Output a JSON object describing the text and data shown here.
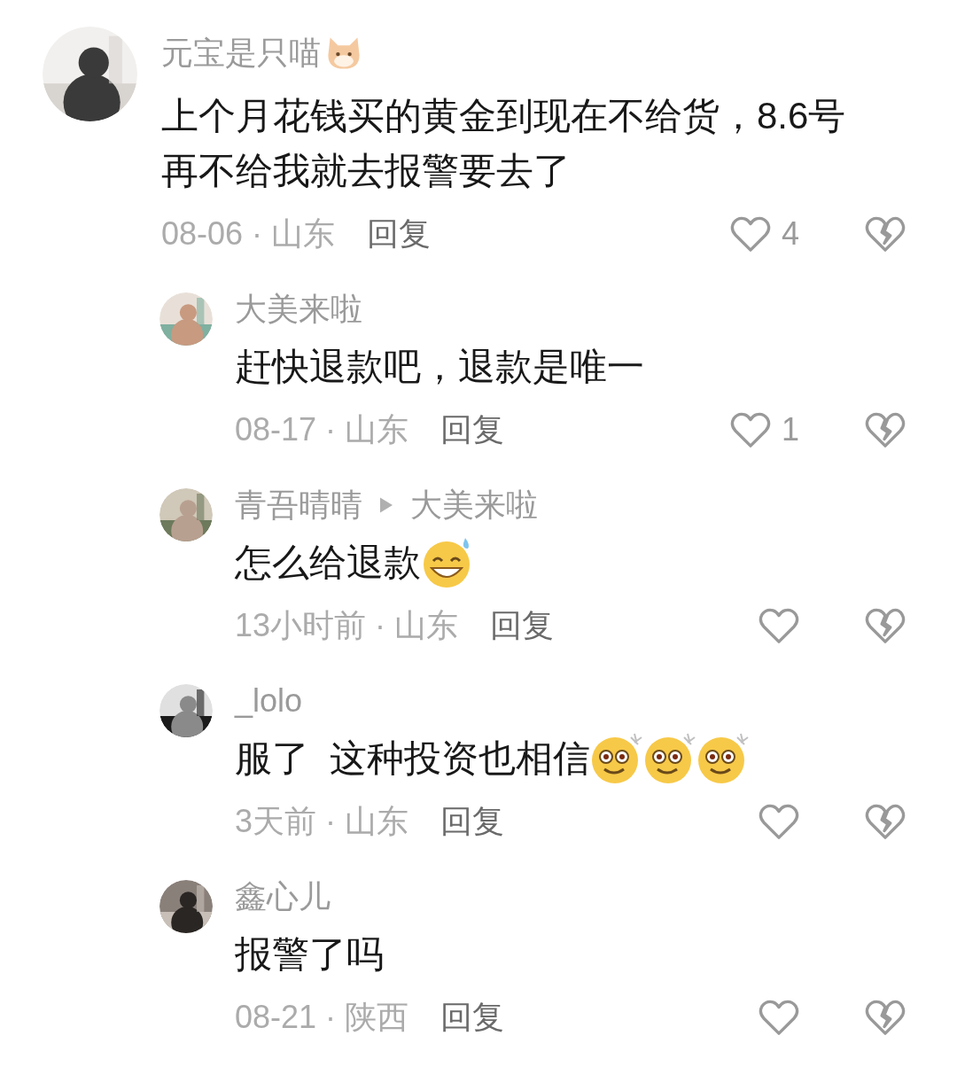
{
  "comment": {
    "author": "元宝是只喵",
    "author_badge": {
      "kind": "cat"
    },
    "lines": [
      "上个月花钱买的黄金到现在不给货，8.6号",
      "再不给我就去报警要去了"
    ],
    "meta": "08-06 · 山东",
    "reply_label": "回复",
    "likes": "4"
  },
  "replies": [
    {
      "author": "大美来啦",
      "lines": [
        "赶快退款吧，退款是唯一"
      ],
      "meta": "08-17 · 山东",
      "reply_label": "回复",
      "likes": "1"
    },
    {
      "author": "青吾晴晴",
      "reply_to": "大美来啦",
      "lines": [
        "怎么给退款"
      ],
      "emojis": [
        {
          "kind": "grin-sweat"
        }
      ],
      "meta": "13小时前 · 山东",
      "reply_label": "回复"
    },
    {
      "author": "_lolo",
      "lines": [
        "服了  这种投资也相信"
      ],
      "emojis": [
        {
          "kind": "dizzy"
        },
        {
          "kind": "dizzy"
        },
        {
          "kind": "dizzy"
        }
      ],
      "meta": "3天前 · 山东",
      "reply_label": "回复"
    },
    {
      "author": "鑫心儿",
      "lines": [
        "报警了吗"
      ],
      "meta": "08-21 · 陕西",
      "reply_label": "回复"
    }
  ]
}
